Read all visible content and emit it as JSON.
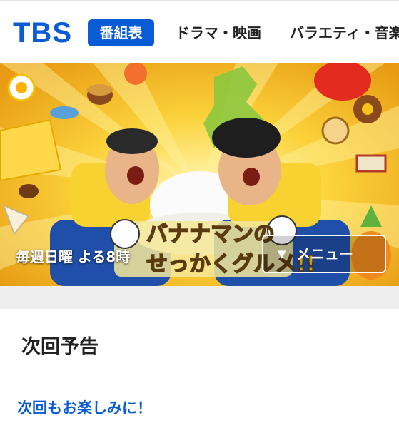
{
  "header": {
    "logo": "TBS",
    "nav": [
      {
        "label": "番組表",
        "active": true
      },
      {
        "label": "ドラマ・映画",
        "active": false
      },
      {
        "label": "バラエティ・音楽",
        "active": false
      }
    ]
  },
  "hero": {
    "schedule": "毎週日曜 よる8時",
    "menu_button": "メニュー",
    "menu_icon": "triangle-down-icon",
    "logo_text_top": "バナナマンの",
    "logo_text_bottom": "せっかくグルメ!!"
  },
  "section": {
    "title": "次回予告",
    "message": "次回もお楽しみに！"
  },
  "colors": {
    "brand_blue": "#0a5bd6",
    "hero_yellow": "#f7c21a",
    "band_gray": "#eeeeee"
  }
}
